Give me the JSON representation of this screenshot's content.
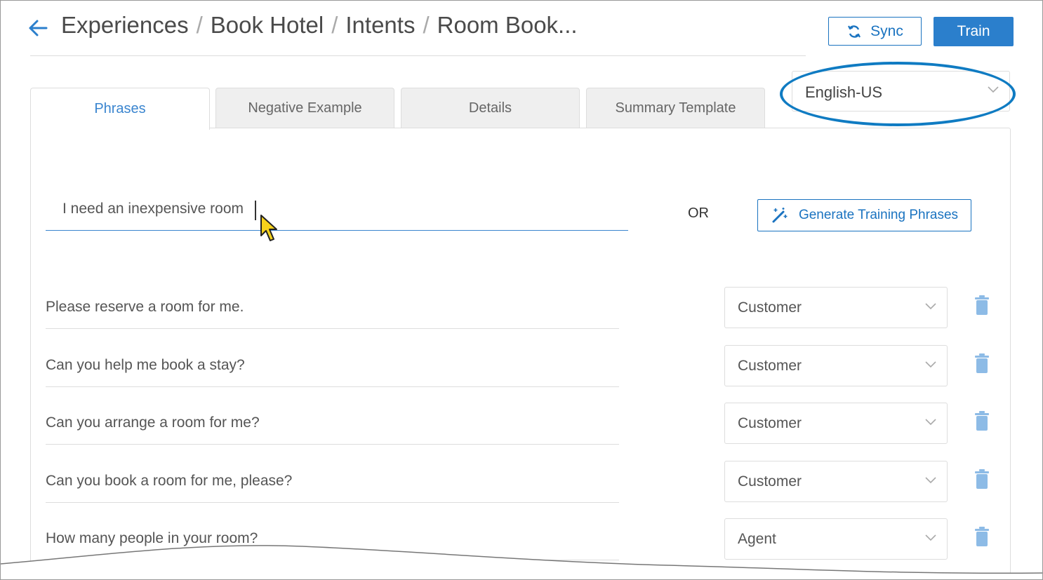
{
  "header": {
    "breadcrumbs": [
      "Experiences",
      "Book Hotel",
      "Intents",
      "Room Book..."
    ],
    "separator": "/",
    "sync_label": "Sync",
    "train_label": "Train"
  },
  "language": {
    "selected": "English-US"
  },
  "tabs": [
    {
      "label": "Phrases",
      "active": true
    },
    {
      "label": "Negative Example",
      "active": false
    },
    {
      "label": "Details",
      "active": false
    },
    {
      "label": "Summary Template",
      "active": false
    }
  ],
  "phrase_entry": {
    "value": "I need an inexpensive room",
    "or_label": "OR",
    "generate_label": "Generate Training Phrases"
  },
  "phrases": [
    {
      "text": "Please reserve a room for me.",
      "role": "Customer"
    },
    {
      "text": "Can you help me book a stay?",
      "role": "Customer"
    },
    {
      "text": "Can you arrange a room for me?",
      "role": "Customer"
    },
    {
      "text": "Can you book a room for me, please?",
      "role": "Customer"
    },
    {
      "text": "How many people in your room?",
      "role": "Agent"
    }
  ],
  "colors": {
    "accent": "#2b7fcc",
    "highlight": "#0f7bc2",
    "icon_light": "#8dbbe6"
  }
}
